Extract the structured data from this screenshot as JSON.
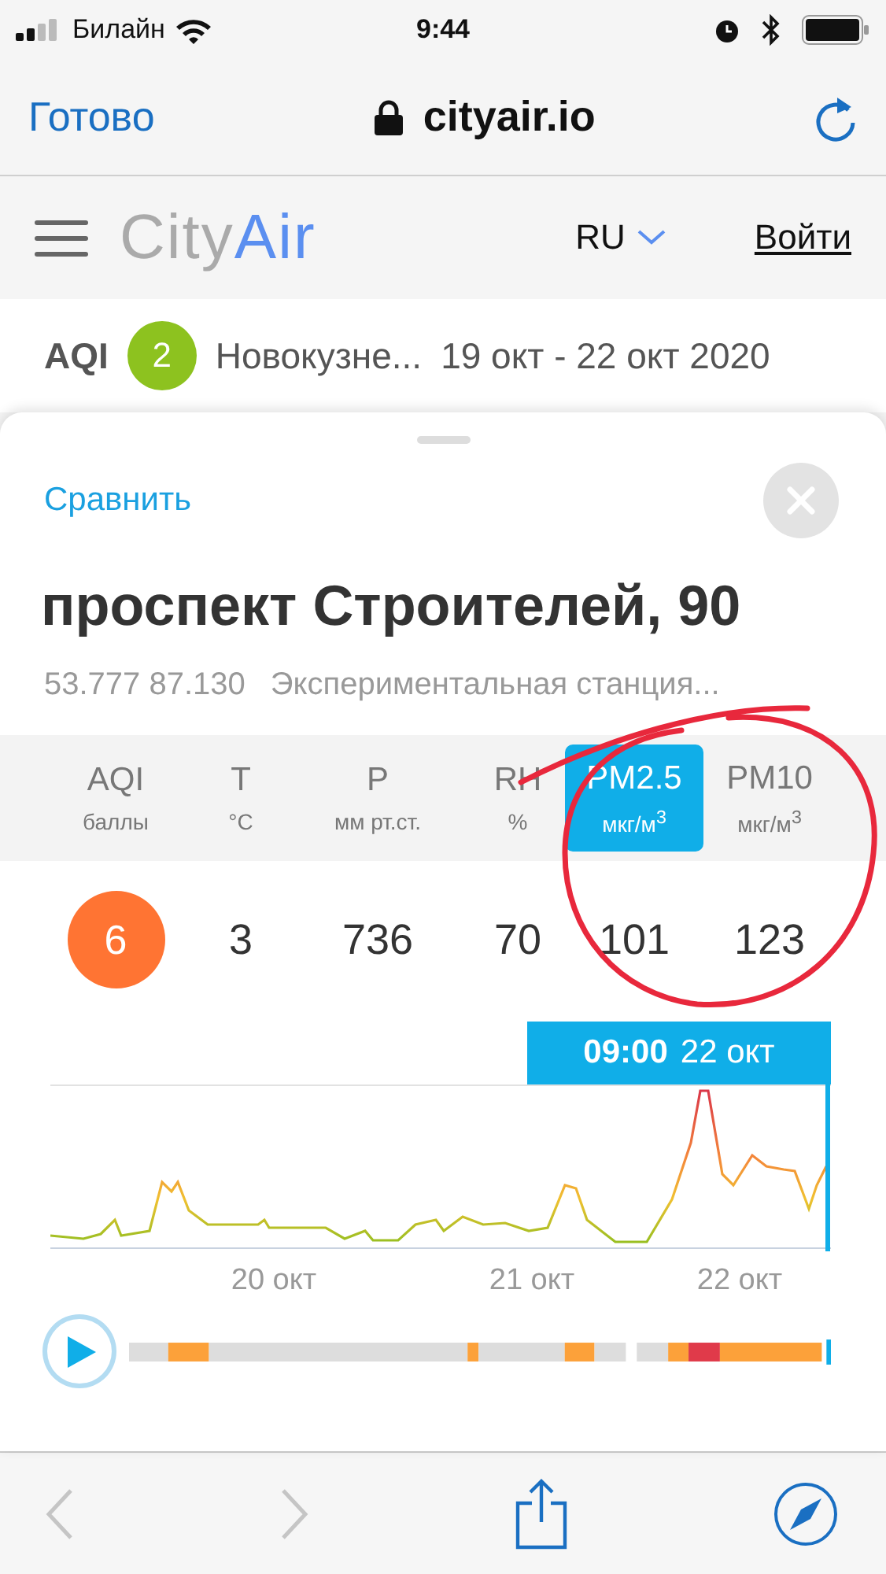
{
  "status_bar": {
    "carrier": "Билайн",
    "time": "9:44"
  },
  "browser_bar": {
    "done": "Готово",
    "url": "cityair.io"
  },
  "header": {
    "logo_first": "City",
    "logo_second": "Air",
    "language": "RU",
    "login": "Войти"
  },
  "summary": {
    "label": "AQI",
    "index": {
      "value": "2",
      "color": "#8dc21f"
    },
    "city": "Новокузне...",
    "period": "19 окт - 22 окт 2020"
  },
  "sheet": {
    "compare": "Сравнить",
    "title": "проспект Строителей, 90",
    "coordinates": "53.777 87.130",
    "station": "Экспериментальная станция...",
    "parameters": [
      {
        "name": "AQI",
        "unit": "баллы",
        "value": "6",
        "kind": "badge",
        "color": "#ff7433",
        "selected": false
      },
      {
        "name": "T",
        "unit": "°C",
        "value": "3",
        "kind": "plain",
        "selected": false
      },
      {
        "name": "P",
        "unit": "мм рт.ст.",
        "value": "736",
        "kind": "plain",
        "selected": false
      },
      {
        "name": "RH",
        "unit": "%",
        "value": "70",
        "kind": "plain",
        "selected": false
      },
      {
        "name": "PM2.5",
        "unit": "мкг/м$^{3}$",
        "value": "101",
        "kind": "plain",
        "selected": true
      },
      {
        "name": "PM10",
        "unit": "мкг/м$^{3}$",
        "value": "123",
        "kind": "plain",
        "selected": false
      }
    ],
    "chart": {
      "time": "09:00",
      "date": "22 окт",
      "x_labels": [
        "20 окт",
        "21 окт",
        "22 окт"
      ]
    }
  },
  "toolbar": {
    "back_disabled": true,
    "forward_disabled": true
  }
}
